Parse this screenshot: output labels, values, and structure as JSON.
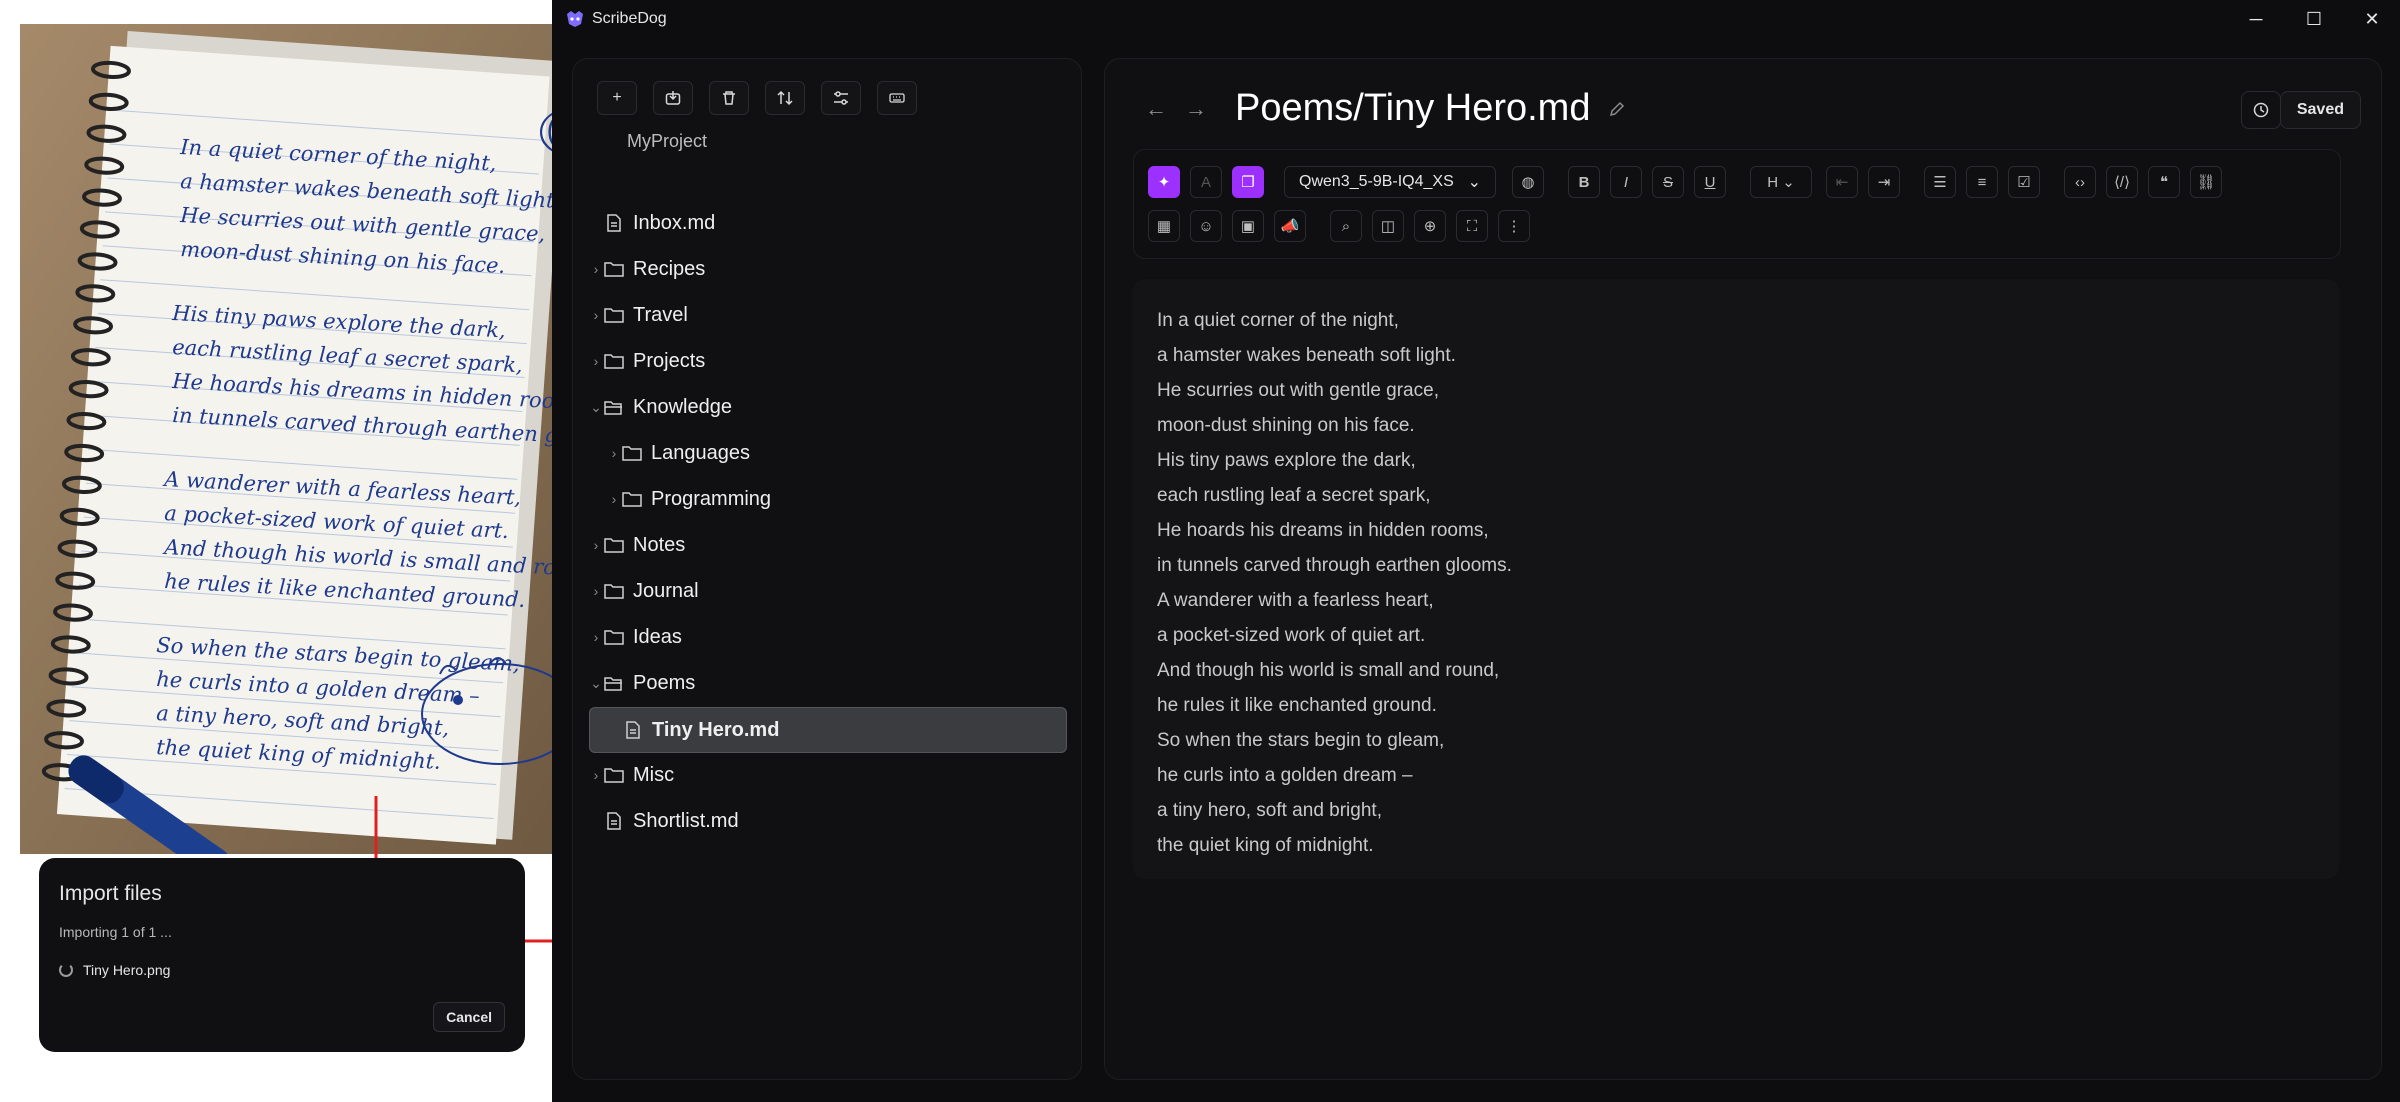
{
  "notebook": {
    "stanzas": [
      [
        "In a quiet corner of the night,",
        "a hamster wakes beneath soft light.",
        "He scurries out with gentle grace,",
        "moon-dust shining on his face."
      ],
      [
        "His tiny paws explore the dark,",
        "each rustling leaf a secret spark,",
        "He hoards his dreams in hidden rooms,",
        "in tunnels carved through earthen glooms."
      ],
      [
        "A wanderer with a fearless heart,",
        "a pocket-sized work of quiet art.",
        "And though his world is small and round,",
        "he rules it like enchanted ground."
      ],
      [
        "So when the stars begin to gleam,",
        "he curls into a golden dream –",
        "a tiny hero, soft and bright,",
        "the quiet king of midnight."
      ]
    ]
  },
  "import_dialog": {
    "title": "Import files",
    "progress": "Importing 1 of 1 ...",
    "file": "Tiny Hero.png",
    "cancel_label": "Cancel"
  },
  "window": {
    "title": "ScribeDog"
  },
  "sidebar": {
    "project": "MyProject",
    "tree": [
      {
        "label": "Inbox.md",
        "kind": "file",
        "depth": 0,
        "chevron": ""
      },
      {
        "label": "Recipes",
        "kind": "folder",
        "depth": 0,
        "chevron": "›"
      },
      {
        "label": "Travel",
        "kind": "folder",
        "depth": 0,
        "chevron": "›"
      },
      {
        "label": "Projects",
        "kind": "folder",
        "depth": 0,
        "chevron": "›"
      },
      {
        "label": "Knowledge",
        "kind": "folder-open",
        "depth": 0,
        "chevron": "⌄"
      },
      {
        "label": "Languages",
        "kind": "folder",
        "depth": 1,
        "chevron": "›"
      },
      {
        "label": "Programming",
        "kind": "folder",
        "depth": 1,
        "chevron": "›"
      },
      {
        "label": "Notes",
        "kind": "folder",
        "depth": 0,
        "chevron": "›"
      },
      {
        "label": "Journal",
        "kind": "folder",
        "depth": 0,
        "chevron": "›"
      },
      {
        "label": "Ideas",
        "kind": "folder",
        "depth": 0,
        "chevron": "›"
      },
      {
        "label": "Poems",
        "kind": "folder-open",
        "depth": 0,
        "chevron": "⌄"
      },
      {
        "label": "Tiny Hero.md",
        "kind": "file",
        "depth": 1,
        "chevron": "",
        "selected": true
      },
      {
        "label": "Misc",
        "kind": "folder",
        "depth": 0,
        "chevron": "›"
      },
      {
        "label": "Shortlist.md",
        "kind": "file",
        "depth": 0,
        "chevron": ""
      }
    ]
  },
  "editor": {
    "title": "Poems/Tiny Hero.md",
    "saved_label": "Saved",
    "model": "Qwen3_5-9B-IQ4_XS",
    "heading_label": "H",
    "accent": "#9b30ff",
    "lines": [
      "In a quiet corner of the night,",
      "a hamster wakes beneath soft light.",
      "He scurries out with gentle grace,",
      "moon-dust shining on his face.",
      "His tiny paws explore the dark,",
      "each rustling leaf a secret spark,",
      "He hoards his dreams in hidden rooms,",
      "in tunnels carved through earthen glooms.",
      "A wanderer with a fearless heart,",
      "a pocket-sized work of quiet art.",
      "And though his world is small and round,",
      "he rules it like enchanted ground.",
      "So when the stars begin to gleam,",
      "he curls into a golden dream –",
      "a tiny hero, soft and bright,",
      "the quiet king of midnight."
    ]
  }
}
